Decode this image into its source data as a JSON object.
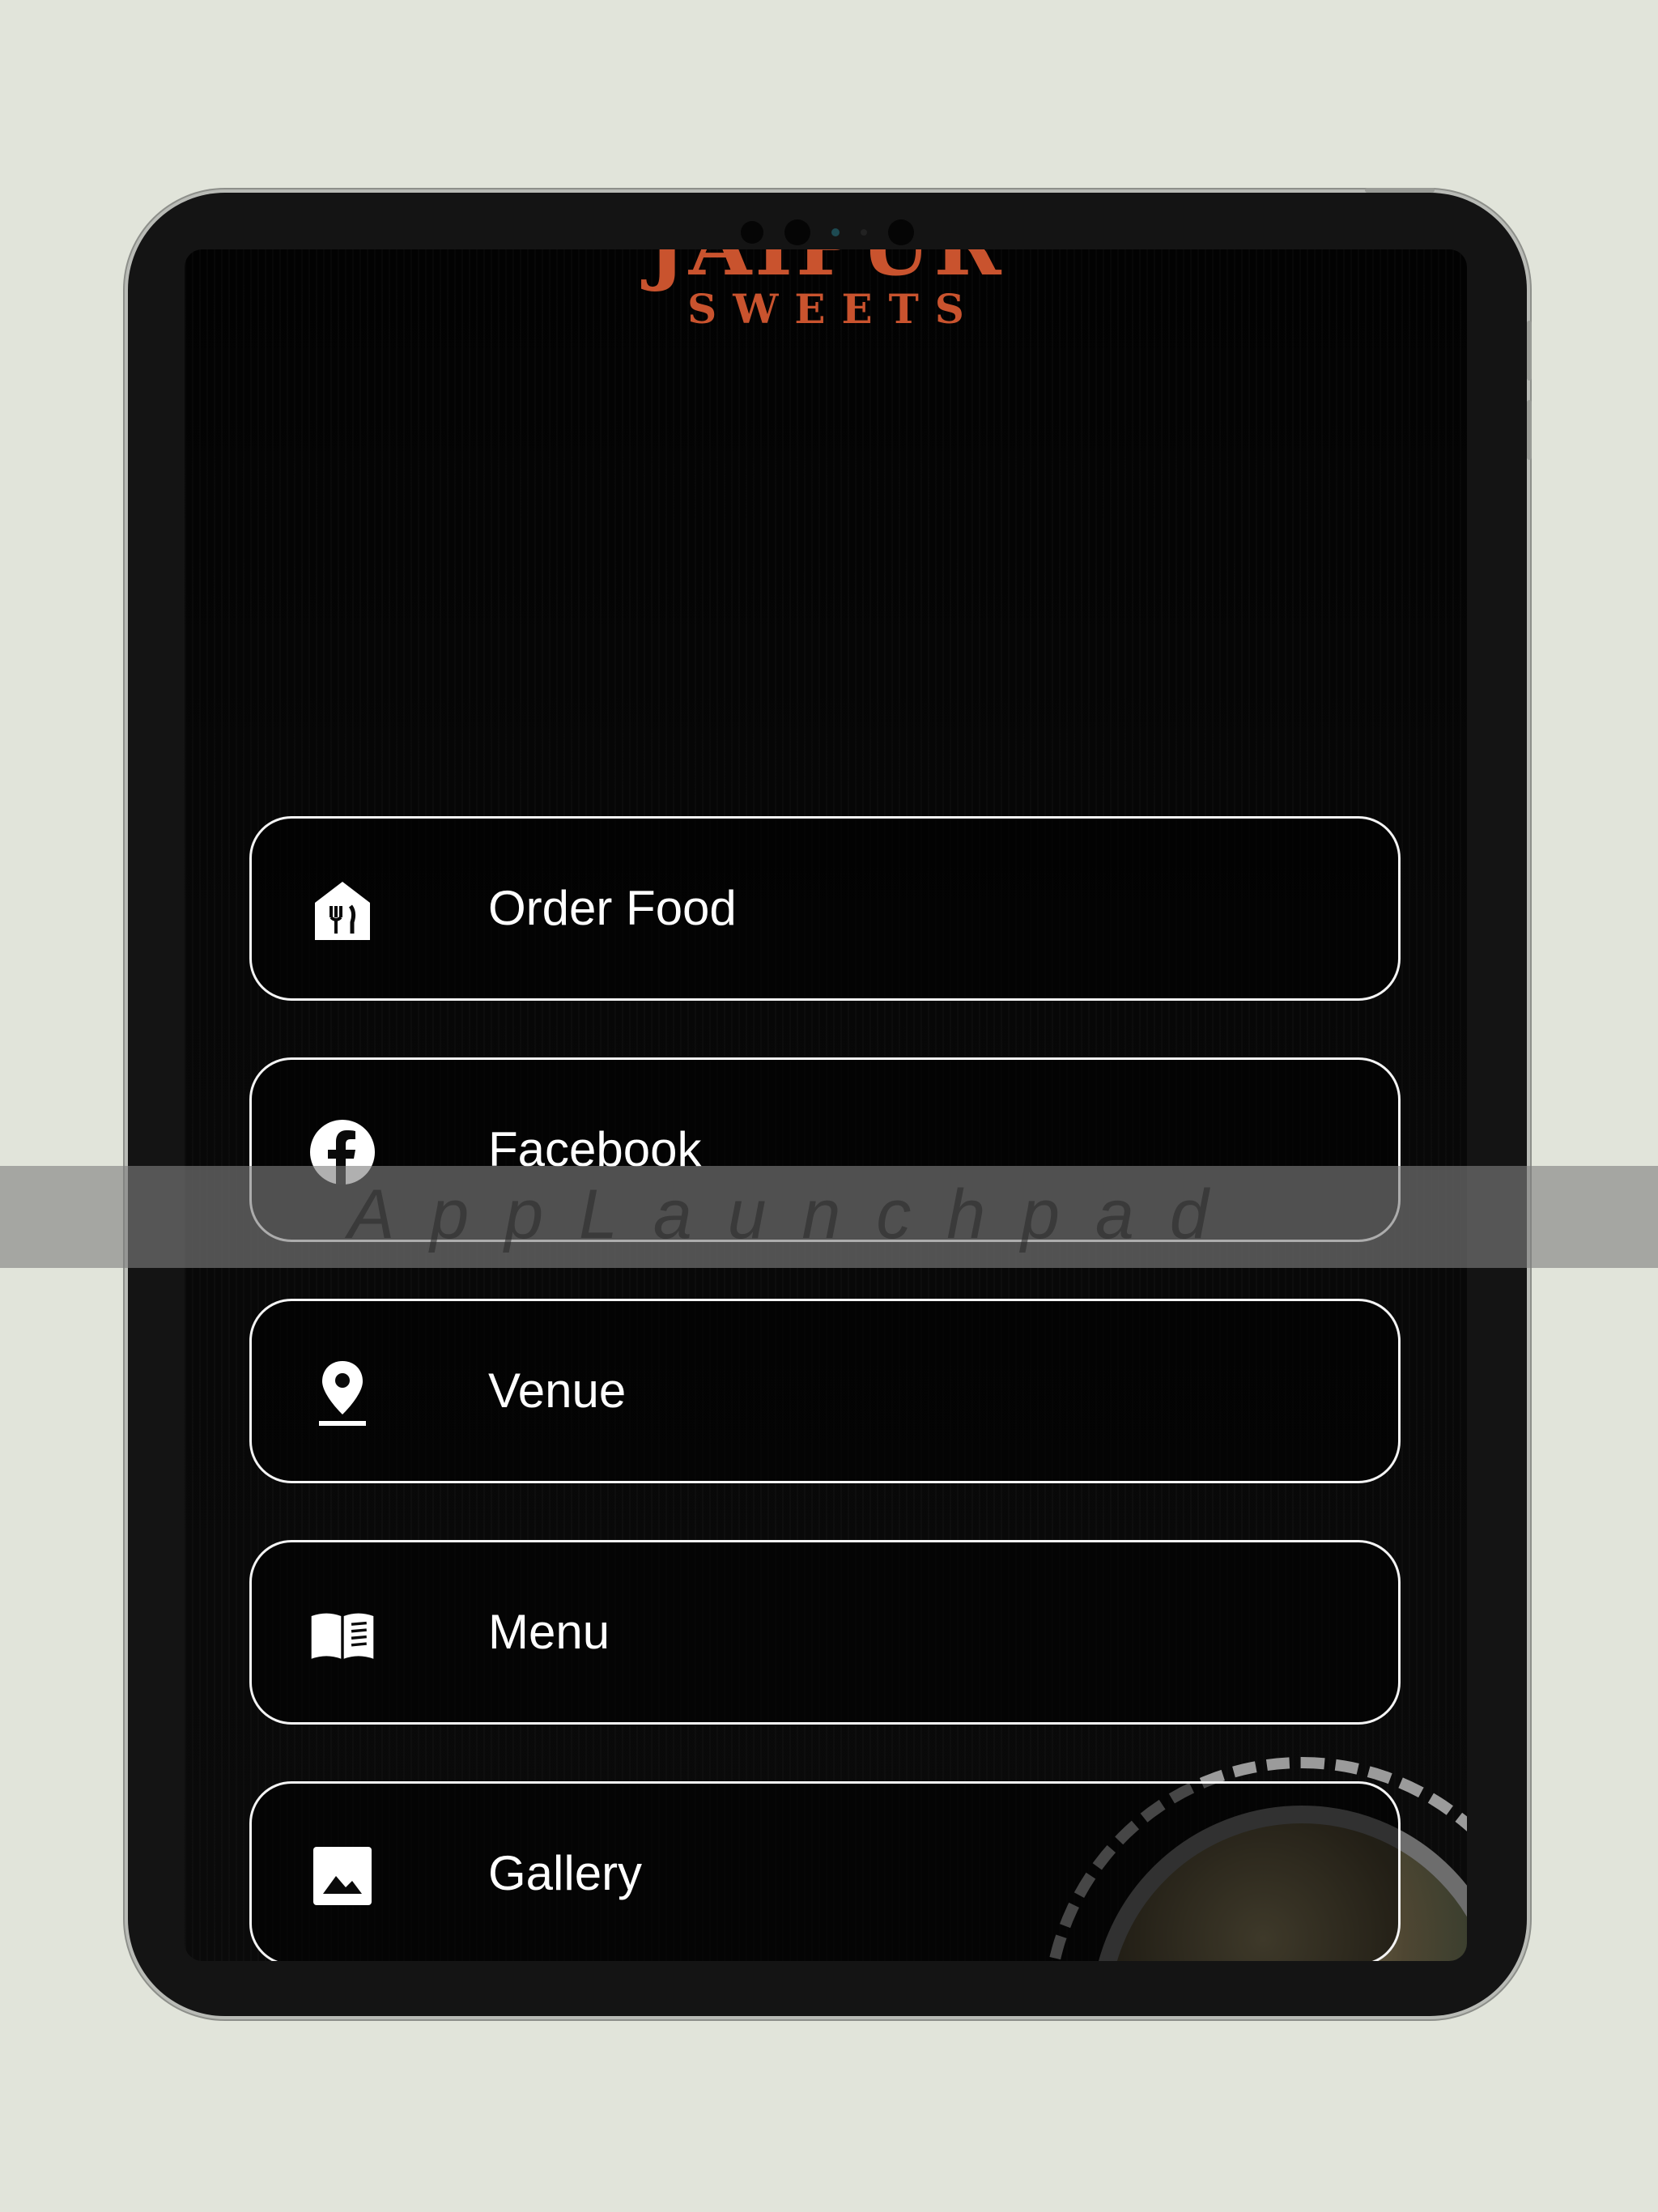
{
  "logo": {
    "top_text": "JAIPUR",
    "sub_text": "SWEETS"
  },
  "buttons": [
    {
      "label": "Order Food",
      "icon": "restaurant-icon"
    },
    {
      "label": "Facebook",
      "icon": "facebook-icon"
    },
    {
      "label": "Venue",
      "icon": "location-pin-icon"
    },
    {
      "label": "Menu",
      "icon": "open-book-icon"
    },
    {
      "label": "Gallery",
      "icon": "image-icon"
    }
  ],
  "watermark": {
    "text": "AppLaunchpad"
  },
  "colors": {
    "background": "#e1e4da",
    "logo": "#c9532e",
    "button_border": "#f4f4f4",
    "device": "#141414"
  }
}
